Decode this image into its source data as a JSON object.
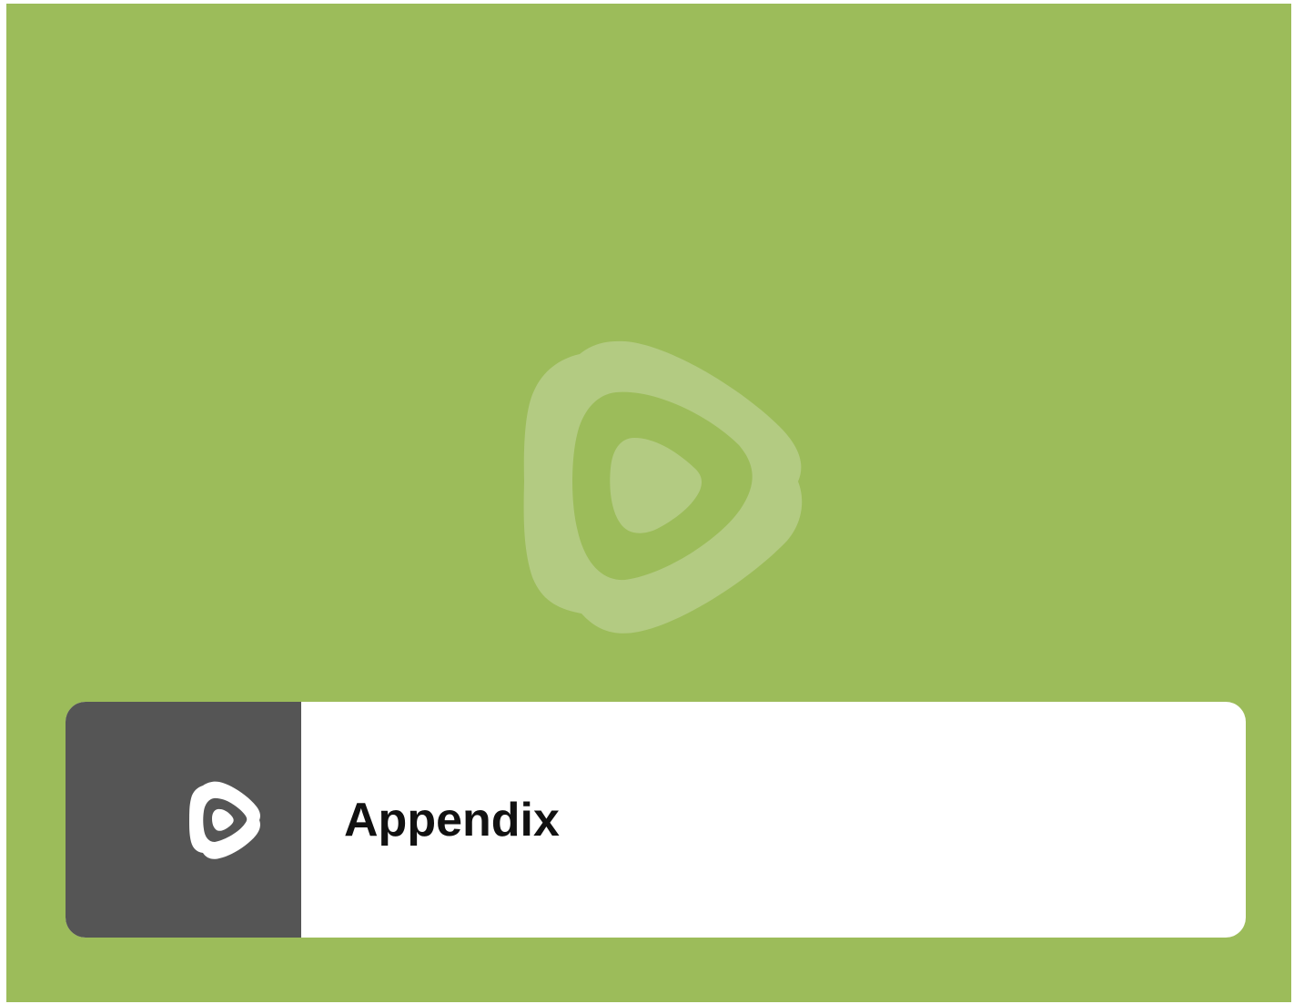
{
  "slide": {
    "background_color": "#9cbc5a",
    "watermark_icon": "play-logo-icon",
    "watermark_color": "#b3cb82"
  },
  "title_card": {
    "side_color": "#555555",
    "logo_icon": "play-logo-icon",
    "title": "Appendix"
  }
}
